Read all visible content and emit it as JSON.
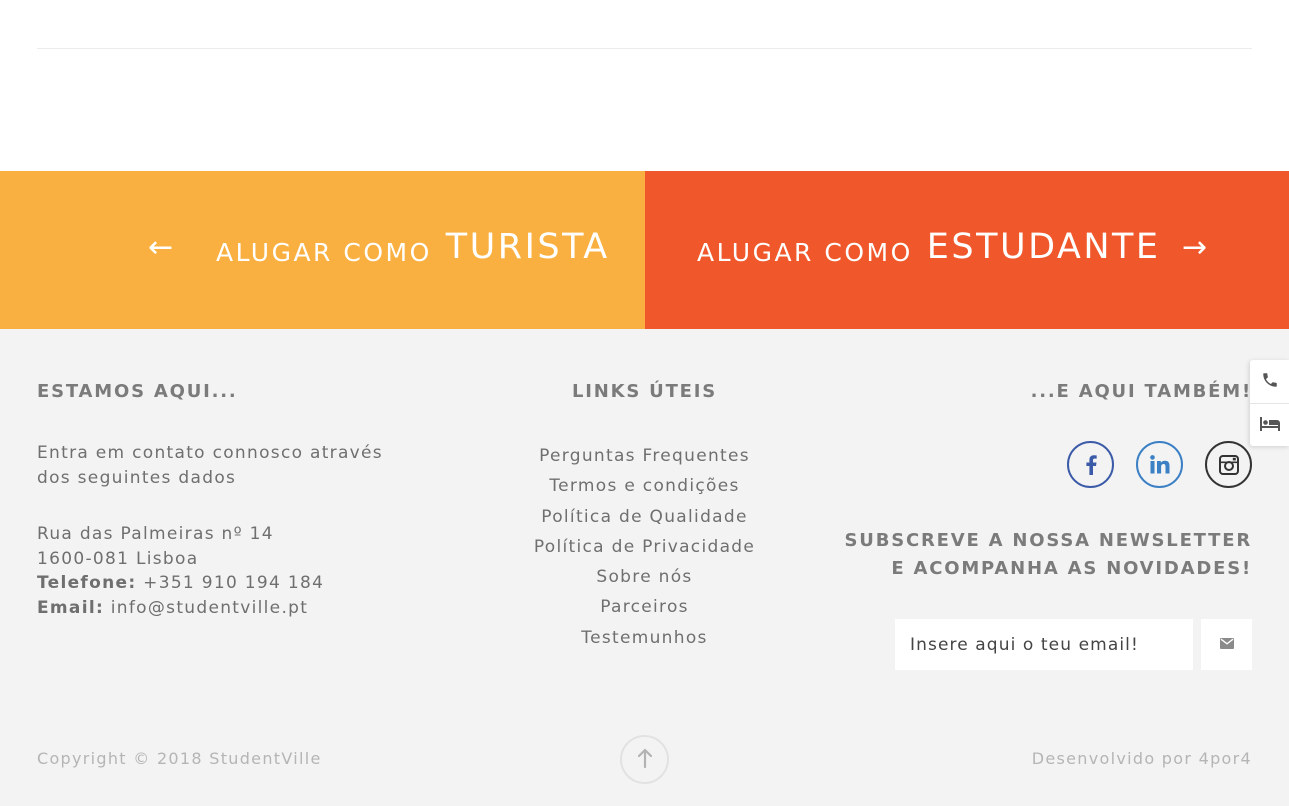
{
  "cta": {
    "tourist": {
      "prefix": "ALUGAR COMO",
      "main": "TURISTA",
      "arrow": "←"
    },
    "student": {
      "prefix": "ALUGAR COMO",
      "main": "ESTUDANTE",
      "arrow": "→"
    }
  },
  "footer": {
    "contact": {
      "title": "ESTAMOS AQUI...",
      "intro": "Entra em contato connosco através dos seguintes dados",
      "street": "Rua das Palmeiras nº 14",
      "city": "1600-081 Lisboa",
      "phone_label": "Telefone:",
      "phone": "+351 910 194 184",
      "email_label": "Email:",
      "email": "info@studentville.pt"
    },
    "links": {
      "title": "LINKS ÚTEIS",
      "items": [
        "Perguntas Frequentes",
        "Termos e condições",
        "Política de Qualidade",
        "Política de Privacidade",
        "Sobre nós",
        "Parceiros",
        "Testemunhos"
      ]
    },
    "social": {
      "title": "...E AQUI TAMBÉM!",
      "icons": [
        "facebook-icon",
        "linkedin-icon",
        "instagram-icon"
      ]
    },
    "newsletter": {
      "title_line1": "SUBSCREVE A NOSSA NEWSLETTER",
      "title_line2": "E ACOMPANHA AS NOVIDADES!",
      "placeholder": "Insere aqui o teu email!",
      "button_icon": "envelope-icon"
    },
    "copyright": "Copyright © 2018 StudentVille",
    "developer": "Desenvolvido por 4por4",
    "back_to_top_icon": "arrow-up-icon"
  },
  "side_tabs": [
    "phone-icon",
    "bed-icon"
  ],
  "colors": {
    "tourist": "#f9b040",
    "student": "#f0572a",
    "footer_bg": "#f3f3f3",
    "facebook": "#3b5ba8",
    "linkedin": "#3b7fc4"
  }
}
